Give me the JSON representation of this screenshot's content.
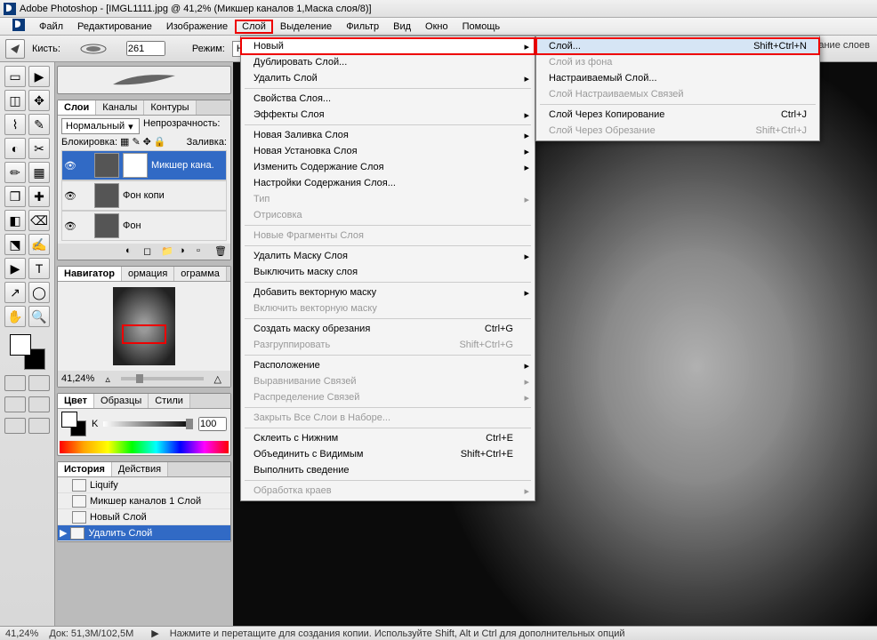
{
  "title": "Adobe Photoshop - [IMGL1111.jpg @ 41,2% (Микшер каналов 1,Маска слоя/8)]",
  "menu": [
    "Файл",
    "Редактирование",
    "Изображение",
    "Слой",
    "Выделение",
    "Фильтр",
    "Вид",
    "Окно",
    "Помощь"
  ],
  "menu_hot_index": 3,
  "options": {
    "brush_label": "Кисть:",
    "brush_value": "261",
    "mode_label": "Режим:",
    "mode_value": "Норма"
  },
  "right_extra": "вание слоев",
  "panels": {
    "layers": {
      "tabs": [
        "Слои",
        "Каналы",
        "Контуры"
      ],
      "mode": "Нормальный",
      "opacity_label": "Непрозрачность:",
      "lock_label": "Блокировка:",
      "fill_label": "Заливка:",
      "items": [
        {
          "name": "Микшер кана.",
          "sel": true,
          "mask": true
        },
        {
          "name": "Фон копи",
          "sel": false,
          "mask": false
        },
        {
          "name": "Фон",
          "sel": false,
          "mask": false
        }
      ]
    },
    "navigator": {
      "tabs": [
        "Навигатор",
        "ормация",
        "ограмма"
      ],
      "zoom": "41,24%"
    },
    "color": {
      "tabs": [
        "Цвет",
        "Образцы",
        "Стили"
      ],
      "k_label": "K",
      "k_value": "100"
    },
    "history": {
      "tabs": [
        "История",
        "Действия"
      ],
      "items": [
        "Liquify",
        "Микшер каналов 1 Слой",
        "Новый Слой",
        "Удалить Слой"
      ],
      "sel_index": 3
    }
  },
  "layer_menu": [
    {
      "label": "Новый",
      "arrow": true,
      "hot": true
    },
    {
      "label": "Дублировать Слой..."
    },
    {
      "label": "Удалить Слой",
      "arrow": true
    },
    {
      "sep": true
    },
    {
      "label": "Свойства Слоя..."
    },
    {
      "label": "Эффекты Слоя",
      "arrow": true
    },
    {
      "sep": true
    },
    {
      "label": "Новая Заливка Слоя",
      "arrow": true
    },
    {
      "label": "Новая Установка Слоя",
      "arrow": true
    },
    {
      "label": "Изменить Содержание Слоя",
      "arrow": true
    },
    {
      "label": "Настройки Содержания Слоя..."
    },
    {
      "label": "Тип",
      "arrow": true,
      "disabled": true
    },
    {
      "label": "Отрисовка",
      "disabled": true
    },
    {
      "sep": true
    },
    {
      "label": "Новые Фрагменты Слоя",
      "disabled": true
    },
    {
      "sep": true
    },
    {
      "label": "Удалить Маску Слоя",
      "arrow": true
    },
    {
      "label": "Выключить маску слоя"
    },
    {
      "sep": true
    },
    {
      "label": "Добавить векторную маску",
      "arrow": true
    },
    {
      "label": "Включить векторную маску",
      "disabled": true
    },
    {
      "sep": true
    },
    {
      "label": "Создать маску обрезания",
      "short": "Ctrl+G"
    },
    {
      "label": "Разгруппировать",
      "short": "Shift+Ctrl+G",
      "disabled": true
    },
    {
      "sep": true
    },
    {
      "label": "Расположение",
      "arrow": true
    },
    {
      "label": "Выравнивание Связей",
      "arrow": true,
      "disabled": true
    },
    {
      "label": "Распределение Связей",
      "arrow": true,
      "disabled": true
    },
    {
      "sep": true
    },
    {
      "label": "Закрыть Все Слои в Наборе...",
      "disabled": true
    },
    {
      "sep": true
    },
    {
      "label": "Склеить с Нижним",
      "short": "Ctrl+E"
    },
    {
      "label": "Объединить с Видимым",
      "short": "Shift+Ctrl+E"
    },
    {
      "label": "Выполнить сведение"
    },
    {
      "sep": true
    },
    {
      "label": "Обработка краев",
      "arrow": true,
      "disabled": true
    }
  ],
  "sub_menu": [
    {
      "label": "Слой...",
      "short": "Shift+Ctrl+N",
      "hot": true,
      "hl": true
    },
    {
      "label": "Слой из фона",
      "disabled": true
    },
    {
      "label": "Настраиваемый Слой..."
    },
    {
      "label": "Слой Настраиваемых Связей",
      "disabled": true
    },
    {
      "sep": true
    },
    {
      "label": "Слой Через Копирование",
      "short": "Ctrl+J"
    },
    {
      "label": "Слой Через Обрезание",
      "short": "Shift+Ctrl+J",
      "disabled": true
    }
  ],
  "status": {
    "zoom": "41,24%",
    "doc": "Док: 51,3M/102,5M",
    "hint": "Нажмите и перетащите для создания копии. Используйте Shift, Alt и Ctrl для дополнительных опций"
  },
  "tools": [
    "▭",
    "▶",
    "◫",
    "✥",
    "⌇",
    "✎",
    "◐",
    "✂",
    "✏",
    "▦",
    "❒",
    "✚",
    "◧",
    "⌫",
    "⬔",
    "✍",
    "▶",
    "T",
    "↗",
    "◯",
    "✋",
    "🔍"
  ]
}
